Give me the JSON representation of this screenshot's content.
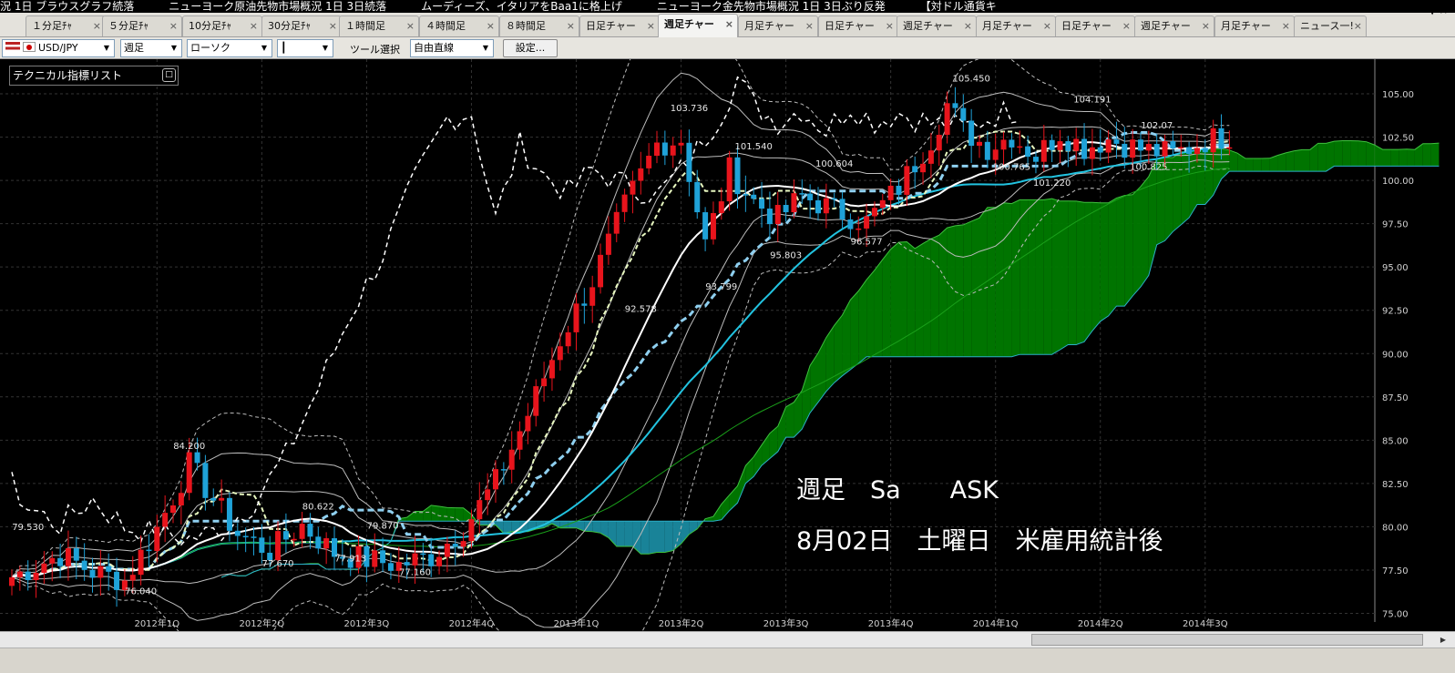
{
  "ticker": [
    "況 1日 ブラウスグラフ続落",
    "ニューヨーク原油先物市場概況 1日 3日続落",
    "ムーディーズ、イタリアをBaa1に格上げ",
    "ニューヨーク金先物市場概況 1日 3日ぶり反発",
    "【対ドル通貨キ"
  ],
  "tabs": [
    {
      "label": "１分足ﾁｬ"
    },
    {
      "label": "５分足ﾁｬ"
    },
    {
      "label": "10分足ﾁｬ"
    },
    {
      "label": "30分足ﾁｬ"
    },
    {
      "label": "１時間足"
    },
    {
      "label": "４時間足"
    },
    {
      "label": "８時間足"
    },
    {
      "label": "日足チャー"
    },
    {
      "label": "週足チャー",
      "active": true
    },
    {
      "label": "月足チャー"
    },
    {
      "label": "日足チャー"
    },
    {
      "label": "週足チャー"
    },
    {
      "label": "月足チャー"
    },
    {
      "label": "日足チャー"
    },
    {
      "label": "週足チャー"
    },
    {
      "label": "月足チャー"
    },
    {
      "label": "ニュース一!"
    }
  ],
  "tab_more": "▼ ×",
  "toolbar": {
    "symbol": "USD/JPY",
    "period": "週足",
    "chart_type": "ローソク",
    "line_style": "┃",
    "tool_label": "ツール選択",
    "tool_value": "自由直線",
    "settings_label": "設定..."
  },
  "tech_panel": {
    "label": "テクニカル指標リスト",
    "button": "□"
  },
  "chart_data": {
    "type": "candlestick",
    "symbol": "USD/JPY",
    "timeframe": "週足",
    "ylim": [
      74.5,
      107
    ],
    "y_ticks": [
      "105.00",
      "102.50",
      "100.00",
      "97.50",
      "95.00",
      "92.50",
      "90.00",
      "87.50",
      "85.00",
      "82.50",
      "80.00",
      "77.50",
      "75.00"
    ],
    "x_ticks": [
      {
        "label": "2012年1Q",
        "week": 18
      },
      {
        "label": "2012年2Q",
        "week": 31
      },
      {
        "label": "2012年3Q",
        "week": 44
      },
      {
        "label": "2012年4Q",
        "week": 57
      },
      {
        "label": "2013年1Q",
        "week": 70
      },
      {
        "label": "2013年2Q",
        "week": 83
      },
      {
        "label": "2013年3Q",
        "week": 96
      },
      {
        "label": "2013年4Q",
        "week": 109
      },
      {
        "label": "2014年1Q",
        "week": 122
      },
      {
        "label": "2014年2Q",
        "week": 135
      },
      {
        "label": "2014年3Q",
        "week": 148
      }
    ],
    "anchors": [
      {
        "w": 0,
        "p": 77.1
      },
      {
        "w": 6,
        "p": 78.4
      },
      {
        "w": 10,
        "p": 77.4
      },
      {
        "w": 14,
        "p": 76.9
      },
      {
        "w": 18,
        "p": 79.9
      },
      {
        "w": 22,
        "p": 83.6
      },
      {
        "w": 25,
        "p": 81.6
      },
      {
        "w": 28,
        "p": 79.6
      },
      {
        "w": 32,
        "p": 78.6
      },
      {
        "w": 36,
        "p": 80.1
      },
      {
        "w": 40,
        "p": 78.5
      },
      {
        "w": 44,
        "p": 78.1
      },
      {
        "w": 48,
        "p": 77.8
      },
      {
        "w": 52,
        "p": 78.3
      },
      {
        "w": 56,
        "p": 79.9
      },
      {
        "w": 60,
        "p": 82.6
      },
      {
        "w": 64,
        "p": 86.5
      },
      {
        "w": 68,
        "p": 90.8
      },
      {
        "w": 72,
        "p": 94.2
      },
      {
        "w": 76,
        "p": 98.5
      },
      {
        "w": 80,
        "p": 102.1
      },
      {
        "w": 83,
        "p": 102.4
      },
      {
        "w": 86,
        "p": 96.3
      },
      {
        "w": 89,
        "p": 100.6
      },
      {
        "w": 92,
        "p": 98.8
      },
      {
        "w": 95,
        "p": 97.8
      },
      {
        "w": 98,
        "p": 99.1
      },
      {
        "w": 102,
        "p": 98.3
      },
      {
        "w": 106,
        "p": 97.6
      },
      {
        "w": 110,
        "p": 99.6
      },
      {
        "w": 114,
        "p": 102.4
      },
      {
        "w": 116,
        "p": 104.4
      },
      {
        "w": 118,
        "p": 102.9
      },
      {
        "w": 121,
        "p": 101.9
      },
      {
        "w": 124,
        "p": 102.6
      },
      {
        "w": 127,
        "p": 101.4
      },
      {
        "w": 130,
        "p": 102.8
      },
      {
        "w": 133,
        "p": 101.9
      },
      {
        "w": 136,
        "p": 102.4
      },
      {
        "w": 140,
        "p": 101.8
      },
      {
        "w": 144,
        "p": 101.5
      },
      {
        "w": 148,
        "p": 102.3
      },
      {
        "w": 151,
        "p": 102.6
      }
    ],
    "annotations": [
      {
        "text": "79.530",
        "week": 2,
        "price": 79.8
      },
      {
        "text": "76.040",
        "week": 16,
        "price": 76.1
      },
      {
        "text": "84.200",
        "week": 22,
        "price": 84.5
      },
      {
        "text": "77.670",
        "week": 33,
        "price": 77.7
      },
      {
        "text": "80.622",
        "week": 38,
        "price": 81.0
      },
      {
        "text": "77.913",
        "week": 42,
        "price": 78.0
      },
      {
        "text": "79.870",
        "week": 46,
        "price": 79.9
      },
      {
        "text": "77.160",
        "week": 50,
        "price": 77.2
      },
      {
        "text": "92.578",
        "week": 78,
        "price": 92.4
      },
      {
        "text": "103.736",
        "week": 84,
        "price": 104.0
      },
      {
        "text": "93.799",
        "week": 88,
        "price": 93.7
      },
      {
        "text": "101.540",
        "week": 92,
        "price": 101.8
      },
      {
        "text": "95.803",
        "week": 96,
        "price": 95.5
      },
      {
        "text": "100.604",
        "week": 102,
        "price": 100.8
      },
      {
        "text": "96.577",
        "week": 106,
        "price": 96.3
      },
      {
        "text": "105.450",
        "week": 119,
        "price": 105.7
      },
      {
        "text": "100.765",
        "week": 124,
        "price": 100.6
      },
      {
        "text": "101.220",
        "week": 129,
        "price": 99.7
      },
      {
        "text": "104.191",
        "week": 134,
        "price": 104.5
      },
      {
        "text": "102.07",
        "week": 142,
        "price": 103.0
      },
      {
        "text": "100.825",
        "week": 141,
        "price": 100.6
      }
    ],
    "overlay_line1": "週足　Sa　　ASK",
    "overlay_line2": "8月02日　土曜日　米雇用統計後",
    "colors": {
      "up": "#e8141c",
      "down": "#1fa2d8",
      "cloud_green": "#007a00",
      "cloud_blue": "#1a8aa0",
      "grid": "#333333"
    }
  }
}
